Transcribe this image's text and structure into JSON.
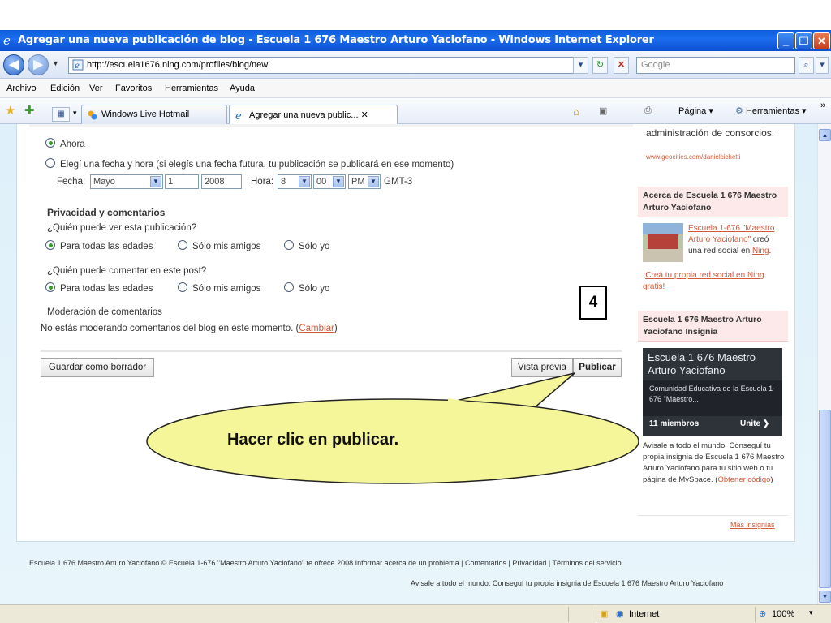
{
  "window": {
    "title": "Agregar una nueva publicación de blog - Escuela 1 676 Maestro Arturo Yaciofano - Windows Internet Explorer"
  },
  "address_bar": {
    "url": "http://escuela1676.ning.com/profiles/blog/new",
    "search_placeholder": "Google"
  },
  "menu": [
    "Archivo",
    "Edición",
    "Ver",
    "Favoritos",
    "Herramientas",
    "Ayuda"
  ],
  "tabs": [
    {
      "label": "Windows Live Hotmail"
    },
    {
      "label": "Agregar una nueva public... ✕"
    }
  ],
  "command_bar": {
    "page_label": "Página",
    "tools_label": "Herramientas",
    "more": "»"
  },
  "publish_time": {
    "option_now": "Ahora",
    "option_date": "Elegí una fecha y hora (si elegís una fecha futura, tu publicación se publicará en ese momento)",
    "date_label": "Fecha:",
    "month": "Mayo",
    "day": "1",
    "year": "2008",
    "time_label": "Hora:",
    "hour": "8",
    "minute": "00",
    "ampm": "PM",
    "timezone": "GMT-3"
  },
  "privacy": {
    "heading": "Privacidad y comentarios",
    "view_question": "¿Quién puede ver esta publicación?",
    "comment_question": "¿Quién puede comentar en este post?",
    "opt_all": "Para todas las edades",
    "opt_friends": "Sólo mis amigos",
    "opt_me": "Sólo yo"
  },
  "moderation": {
    "heading": "Moderación de comentarios",
    "text": "No estás moderando comentarios del blog en este momento. (",
    "link": "Cambiar",
    "close": ")"
  },
  "actions": {
    "draft": "Guardar como borrador",
    "preview": "Vista previa",
    "publish": "Publicar"
  },
  "annotation": {
    "step": "4",
    "callout": "Hacer clic en publicar."
  },
  "sidebar": {
    "top_text": "administración de consorcios.",
    "top_link": "www.geocities.com/danielcichetti",
    "about_heading": "Acerca de Escuela 1 676 Maestro Arturo Yaciofano",
    "about_link": "Escuela 1-676 \"Maestro Arturo Yaciofano\"",
    "about_text1": "creó",
    "about_text2": "una red social en",
    "about_ning": "Ning",
    "about_period": ".",
    "create_link": "¡Creá tu propia red social en Ning gratis!",
    "badge_heading": "Escuela 1 676 Maestro Arturo Yaciofano Insignia",
    "badge_title": "Escuela 1 676  Maestro Arturo Yaciofano",
    "badge_desc": "Comunidad Educativa de la Escuela 1-676 \"Maestro...",
    "badge_members": "11 miembros",
    "badge_join": "Unite",
    "promo_text": "Avisale a todo el mundo. Conseguí tu propia insignia de Escuela 1 676 Maestro Arturo Yaciofano para tu sitio web o tu página de MySpace.",
    "promo_link_open": "(",
    "promo_link": "Obtener código",
    "promo_link_close": ")",
    "more_badges": "Más insignias"
  },
  "footer": {
    "line1": "Escuela 1 676 Maestro Arturo Yaciofano © Escuela 1-676 \"Maestro Arturo Yaciofano\" te ofrece 2008 Informar acerca de un problema | Comentarios | Privacidad | Términos del servicio",
    "line2": "Avisale a todo el mundo. Conseguí tu propia insignia de Escuela 1 676 Maestro Arturo Yaciofano"
  },
  "status_bar": {
    "zone": "Internet",
    "zoom": "100%"
  },
  "colors": {
    "titlebar": "#0b57d0",
    "link": "#d35a3a",
    "callout_fill": "#f5f59a",
    "radio_on": "#3a9a2c"
  }
}
